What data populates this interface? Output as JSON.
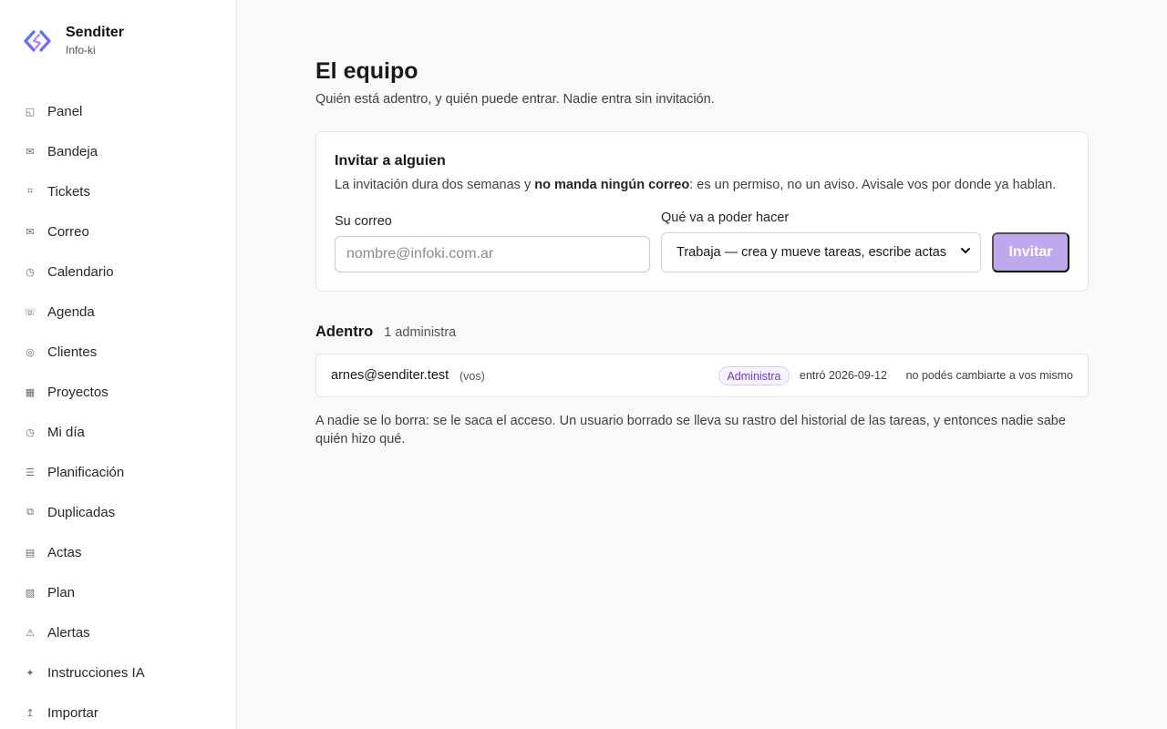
{
  "brand": {
    "name": "Senditer",
    "org": "Info-ki"
  },
  "sidebar": {
    "items": [
      {
        "label": "Panel",
        "icon": "◱"
      },
      {
        "label": "Bandeja",
        "icon": "✉"
      },
      {
        "label": "Tickets",
        "icon": "⌗"
      },
      {
        "label": "Correo",
        "icon": "✉"
      },
      {
        "label": "Calendario",
        "icon": "◷"
      },
      {
        "label": "Agenda",
        "icon": "☏"
      },
      {
        "label": "Clientes",
        "icon": "◎"
      },
      {
        "label": "Proyectos",
        "icon": "▦"
      },
      {
        "label": "Mi día",
        "icon": "◷"
      },
      {
        "label": "Planificación",
        "icon": "☰"
      },
      {
        "label": "Duplicadas",
        "icon": "⧉"
      },
      {
        "label": "Actas",
        "icon": "▤"
      },
      {
        "label": "Plan",
        "icon": "▧"
      },
      {
        "label": "Alertas",
        "icon": "⚠"
      },
      {
        "label": "Instrucciones IA",
        "icon": "✦"
      },
      {
        "label": "Importar",
        "icon": "↥"
      }
    ]
  },
  "page": {
    "title": "El equipo",
    "subtitle": "Quién está adentro, y quién puede entrar. Nadie entra sin invitación."
  },
  "invite": {
    "title": "Invitar a alguien",
    "desc_before": "La invitación dura dos semanas y ",
    "desc_bold": "no manda ningún correo",
    "desc_after": ": es un permiso, no un aviso. Avisale vos por donde ya hablan.",
    "email_label": "Su correo",
    "email_placeholder": "nombre@infoki.com.ar",
    "email_value": "",
    "role_label": "Qué va a poder hacer",
    "role_selected": "Trabaja — crea y mueve tareas, escribe actas",
    "button_label": "Invitar"
  },
  "members": {
    "title": "Adentro",
    "count": "1 administra",
    "rows": [
      {
        "email": "arnes@senditer.test",
        "you": "(vos)",
        "role": "Administra",
        "joined": "entró 2026-09-12",
        "note": "no podés cambiarte a vos mismo"
      }
    ]
  },
  "footnote": "A nadie se lo borra: se le saca el acceso. Un usuario borrado se lleva su rastro del historial de las tareas, y entonces nadie sabe quién hizo qué.",
  "colors": {
    "accent": "#bea9ee",
    "badge_text": "#6d3cc9",
    "badge_bg": "#f7f2fe"
  }
}
